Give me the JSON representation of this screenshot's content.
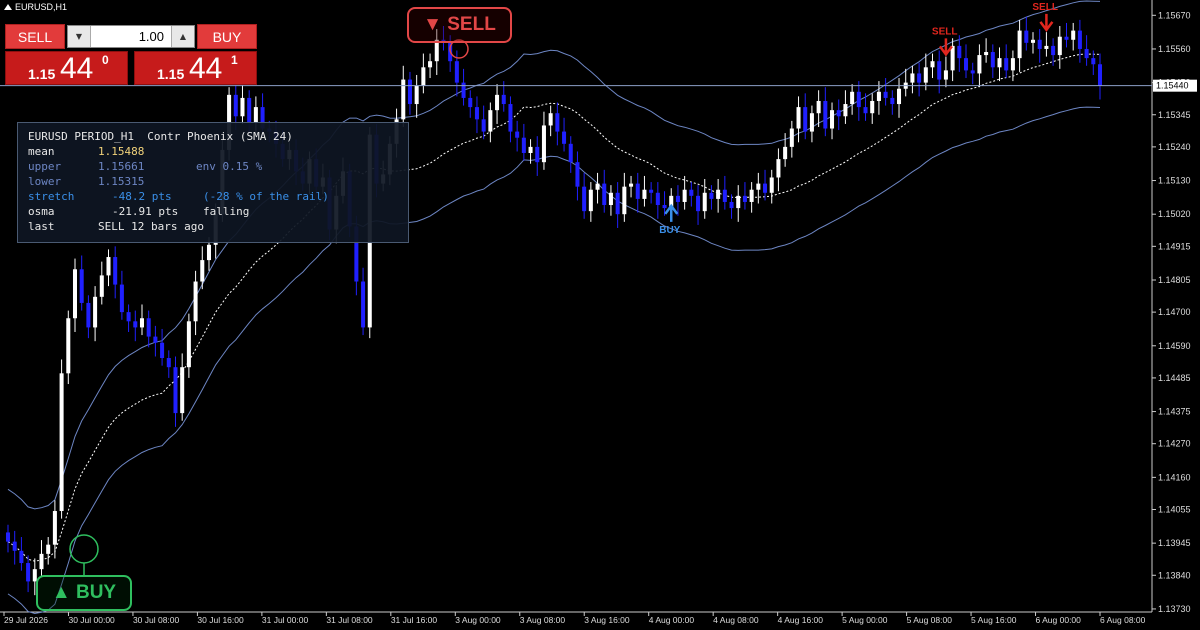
{
  "window": {
    "symbol_title": "EURUSD,H1"
  },
  "trade_panel": {
    "sell_label": "SELL",
    "buy_label": "BUY",
    "lot_value": "1.00",
    "sell_price": {
      "prefix": "1.15",
      "big": "44",
      "sup": "0"
    },
    "buy_price": {
      "prefix": "1.15",
      "big": "44",
      "sup": "1"
    }
  },
  "info_panel": {
    "header": "EURUSD PERIOD_H1  Contr Phoenix (SMA 24)",
    "rows": [
      {
        "key": "mean",
        "value": "1.15488",
        "note": ""
      },
      {
        "key": "upper",
        "value": "1.15661",
        "note": "env 0.15 %"
      },
      {
        "key": "lower",
        "value": "1.15315",
        "note": ""
      },
      {
        "key": "stretch",
        "value": "-48.2 pts",
        "note": "(-28 % of the rail)"
      },
      {
        "key": "osma",
        "value": "-21.91 pts",
        "note": "falling"
      },
      {
        "key": "last",
        "value": "SELL 12 bars ago",
        "note": ""
      }
    ]
  },
  "badges": {
    "sell": "▼ SELL",
    "buy": "▲ BUY"
  },
  "chart_data": {
    "type": "candlestick",
    "symbol": "EURUSD",
    "timeframe": "H1",
    "current_price": "1.15440",
    "price_axis_labels": [
      "1.15670",
      "1.15560",
      "1.15450",
      "1.15345",
      "1.15240",
      "1.15130",
      "1.15020",
      "1.14915",
      "1.14805",
      "1.14700",
      "1.14590",
      "1.14485",
      "1.14375",
      "1.14270",
      "1.14160",
      "1.14055",
      "1.13945",
      "1.13840",
      "1.13730"
    ],
    "time_axis_labels": [
      "29 Jul 2026",
      "30 Jul 00:00",
      "30 Jul 08:00",
      "30 Jul 16:00",
      "31 Jul 00:00",
      "31 Jul 08:00",
      "31 Jul 16:00",
      "3 Aug 00:00",
      "3 Aug 08:00",
      "3 Aug 16:00",
      "4 Aug 00:00",
      "4 Aug 08:00",
      "4 Aug 16:00",
      "5 Aug 00:00",
      "5 Aug 08:00",
      "5 Aug 16:00",
      "6 Aug 00:00",
      "6 Aug 08:00"
    ],
    "ylim": [
      1.1372,
      1.1572
    ],
    "grid": false,
    "colors": {
      "bull": "#ffffff",
      "bear": "#2020ff",
      "bands": "#6d86c4",
      "mean": "#ffffff",
      "sell_arrow": "#e0261e",
      "buy_arrow": "#3a8fe8",
      "green": "#2fbf5f",
      "red": "#e24747"
    },
    "signals": [
      {
        "type": "SELL",
        "label": "SELL",
        "bar": 140
      },
      {
        "type": "SELL",
        "label": "SELL",
        "bar": 155
      },
      {
        "type": "BUY",
        "label": "BUY",
        "bar": 99
      }
    ],
    "series": [
      {
        "name": "close",
        "values": [
          1.1395,
          1.1392,
          1.1388,
          1.1382,
          1.1386,
          1.1391,
          1.1394,
          1.1405,
          1.145,
          1.1468,
          1.1484,
          1.1473,
          1.1465,
          1.1475,
          1.1482,
          1.1488,
          1.1479,
          1.147,
          1.1467,
          1.1465,
          1.1468,
          1.1462,
          1.146,
          1.1455,
          1.1452,
          1.1437,
          1.1452,
          1.1467,
          1.148,
          1.1487,
          1.1492,
          1.1502,
          1.1523,
          1.1541,
          1.1534,
          1.154,
          1.1532,
          1.1537,
          1.153,
          1.1529,
          1.1525,
          1.152,
          1.1523,
          1.1516,
          1.1512,
          1.152,
          1.1511,
          1.1514,
          1.1497,
          1.1508,
          1.1516,
          1.1498,
          1.148,
          1.1465,
          1.1528,
          1.1512,
          1.1515,
          1.1525,
          1.1533,
          1.1546,
          1.1538,
          1.1544,
          1.155,
          1.1552,
          1.1559,
          1.1558,
          1.1552,
          1.1545,
          1.154,
          1.1537,
          1.1533,
          1.1529,
          1.1536,
          1.1541,
          1.1538,
          1.1529,
          1.1527,
          1.1522,
          1.1524,
          1.1519,
          1.1531,
          1.1535,
          1.1529,
          1.1525,
          1.1519,
          1.1511,
          1.1503,
          1.151,
          1.1512,
          1.1505,
          1.1509,
          1.1502,
          1.1511,
          1.1512,
          1.1507,
          1.151,
          1.1509,
          1.1505,
          1.1504,
          1.1508,
          1.1506,
          1.151,
          1.1508,
          1.1503,
          1.1509,
          1.1507,
          1.151,
          1.1506,
          1.1504,
          1.1508,
          1.1506,
          1.151,
          1.1512,
          1.1509,
          1.1514,
          1.152,
          1.1524,
          1.153,
          1.1537,
          1.1529,
          1.1535,
          1.1539,
          1.153,
          1.1536,
          1.1534,
          1.1538,
          1.1542,
          1.1537,
          1.1535,
          1.1539,
          1.1542,
          1.154,
          1.1538,
          1.1543,
          1.1545,
          1.1548,
          1.1545,
          1.155,
          1.1552,
          1.1546,
          1.1549,
          1.1557,
          1.1553,
          1.1549,
          1.1548,
          1.1554,
          1.1555,
          1.155,
          1.1553,
          1.1549,
          1.1553,
          1.1562,
          1.1558,
          1.1559,
          1.1556,
          1.1557,
          1.1554,
          1.156,
          1.1559,
          1.1562,
          1.1556,
          1.1553,
          1.1551,
          1.1544
        ]
      }
    ]
  }
}
